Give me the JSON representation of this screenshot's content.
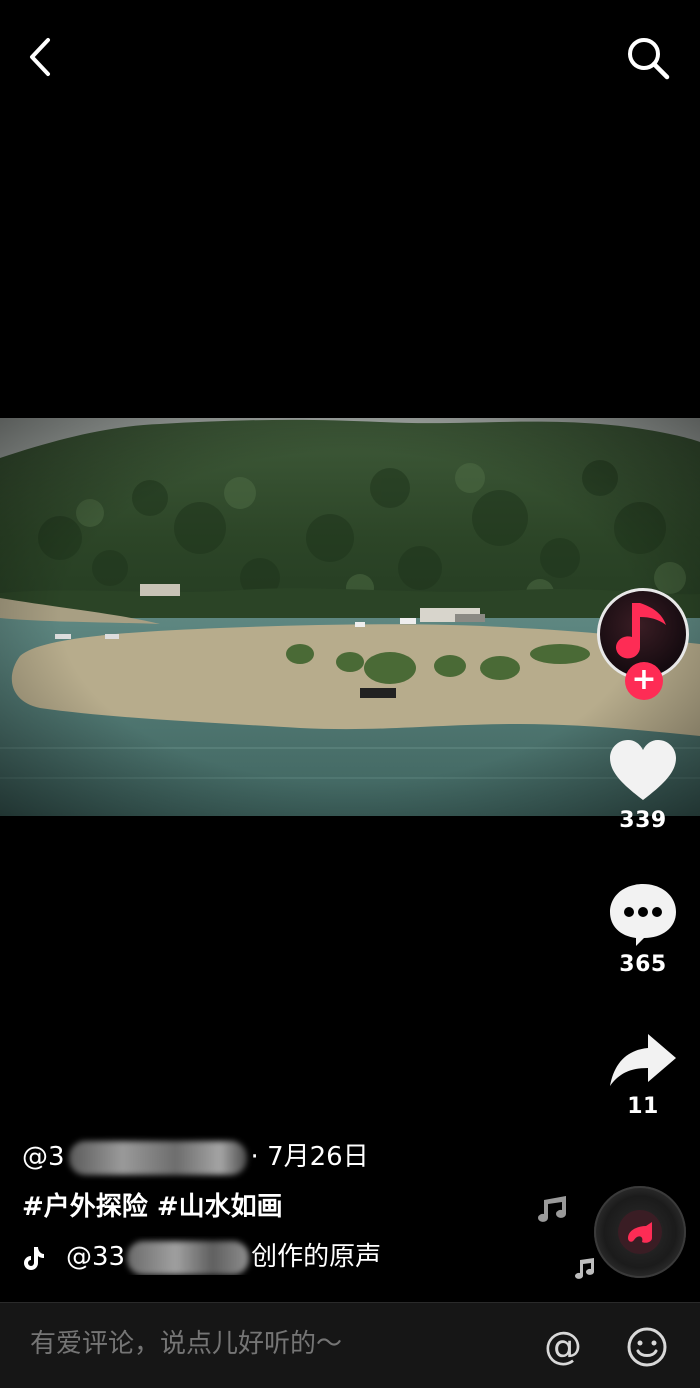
{
  "top_bar": {
    "back_icon": "chevron-left-icon",
    "search_icon": "search-icon"
  },
  "video": {
    "description_colors": {
      "sky": "#9aa19c",
      "forest": "#2f4a2a",
      "water": "#4f7a74",
      "sand": "#b9ae8f"
    }
  },
  "actions": {
    "like_count": "339",
    "comment_count": "365",
    "share_count": "11",
    "follow_label": "+"
  },
  "info": {
    "author_prefix": "@3",
    "author_suffix": "· 7月26日",
    "hashtags": "#户外探险 #山水如画",
    "music_prefix": "@33",
    "music_suffix": "创作的原声"
  },
  "comment_bar": {
    "placeholder": "有爱评论，说点儿好听的～",
    "at_label": "@"
  },
  "colors": {
    "accent": "#fe2c55",
    "background": "#000000",
    "comment_bar": "#161616"
  }
}
